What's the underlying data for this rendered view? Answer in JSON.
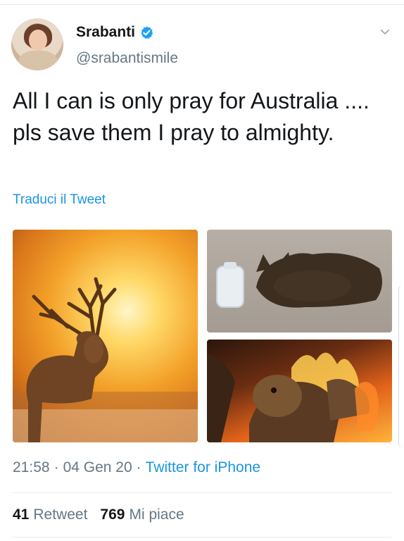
{
  "author": {
    "display_name": "Srabanti",
    "handle": "@srabantismile",
    "verified": true
  },
  "icons": {
    "verified": "verified-badge-icon",
    "menu": "chevron-down-icon"
  },
  "tweet": {
    "text": "All I can is only pray for Australia .... pls save them I pray to almighty.",
    "translate_link": "Traduci il Tweet"
  },
  "media": {
    "count": 3,
    "tiles": [
      "deer",
      "burnt-cat",
      "burnt-animals"
    ]
  },
  "meta": {
    "time": "21:58",
    "separator": "·",
    "date": "04 Gen 20",
    "source": "Twitter for iPhone"
  },
  "stats": {
    "retweets_count": "41",
    "retweets_label": "Retweet",
    "likes_count": "769",
    "likes_label": "Mi piace"
  },
  "colors": {
    "link": "#1b95e0",
    "text_primary": "#14171a",
    "text_secondary": "#657786",
    "divider": "#e6ecf0"
  }
}
